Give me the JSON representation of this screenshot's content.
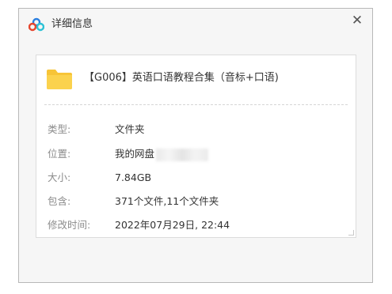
{
  "window": {
    "title": "详细信息",
    "close_glyph": "✕",
    "app_icon": "baidu-netdisk-logo-icon"
  },
  "file": {
    "icon": "folder-icon",
    "icon_color": "#f7c437",
    "name": "【G006】英语口语教程合集（音标+口语)"
  },
  "details": {
    "type_label": "类型:",
    "type_value": "文件夹",
    "location_label": "位置:",
    "location_value": "我的网盘",
    "size_label": "大小:",
    "size_value": "7.84GB",
    "contains_label": "包含:",
    "contains_value": "371个文件,11个文件夹",
    "modified_label": "修改时间:",
    "modified_value": "2022年07月29日, 22:44"
  },
  "colors": {
    "logo_blue": "#2a7fe0",
    "logo_red": "#e5452d",
    "logo_cyan": "#2cc2d6"
  }
}
